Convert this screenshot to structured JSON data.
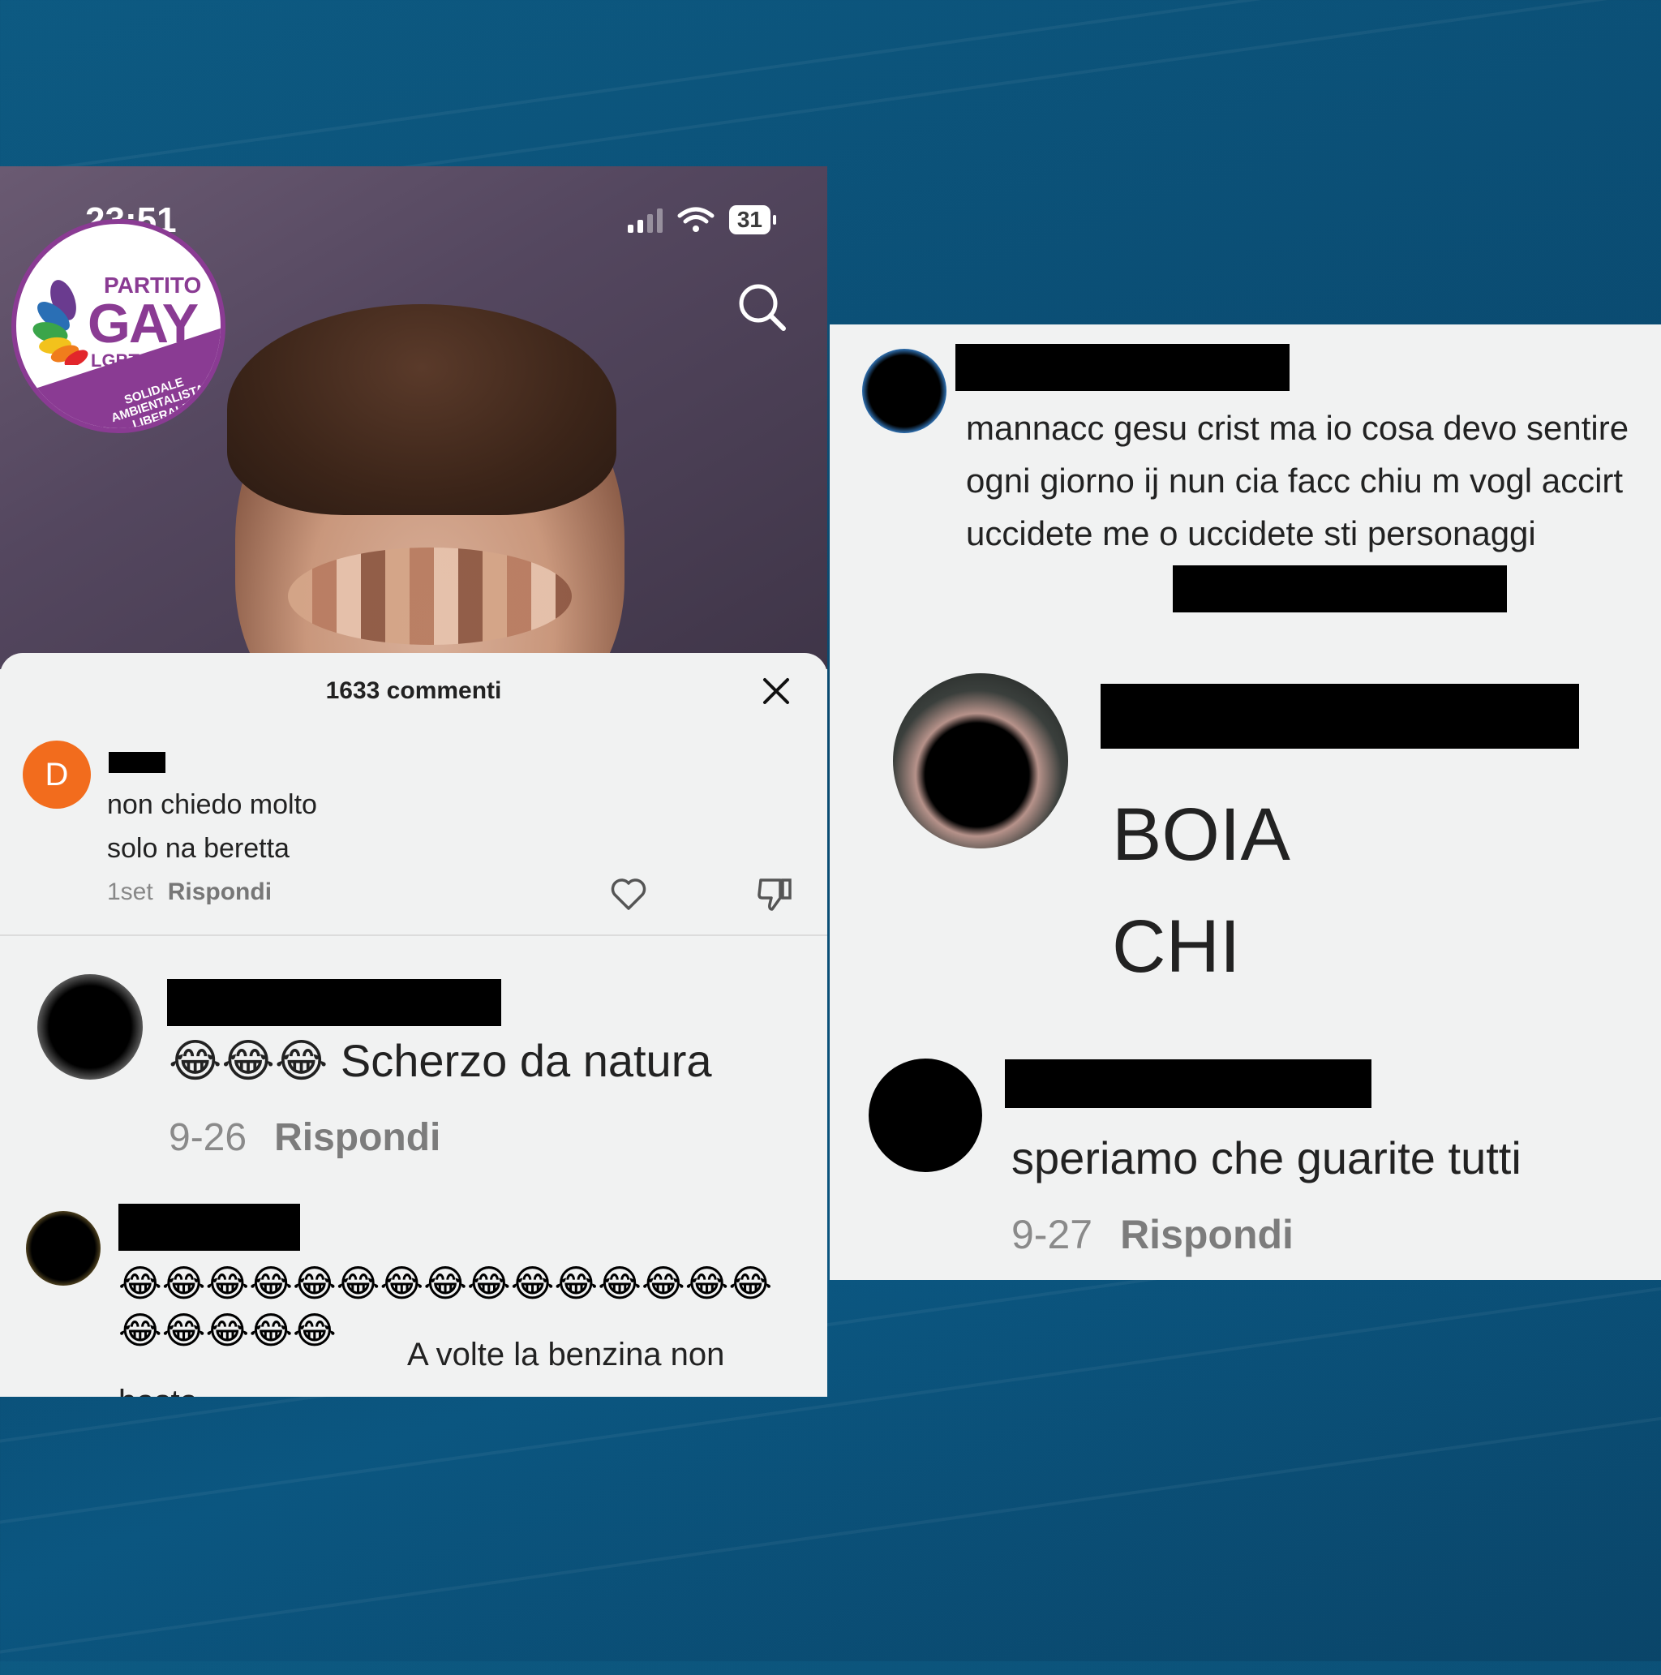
{
  "left": {
    "status": {
      "time": "23:51",
      "battery": "31"
    },
    "logo": {
      "line1": "PARTITO",
      "line2": "GAY",
      "line3": "LGBT+",
      "band": "SOLIDALE AMBIENTALISTA LIBERALE"
    },
    "comments_header": "1633 commenti",
    "comment1": {
      "avatar_letter": "D",
      "text_line1": "non chiedo molto",
      "text_line2": "solo na beretta",
      "date": "1set",
      "reply": "Rispondi"
    },
    "comment2": {
      "text": "😂😂😂 Scherzo da natura",
      "date": "9-26",
      "reply": "Rispondi"
    },
    "comment3": {
      "emoji": "😂😂😂😂😂😂😂😂😂😂😂😂😂😂😂😂😂😂😂😂",
      "text": "A volte la benzina non basta"
    }
  },
  "right": {
    "comment1": {
      "text": "mannacc gesu crist ma io cosa devo sentire ogni giorno ij nun cia facc chiu m vogl accirt uccidete me o uccidete sti personaggi"
    },
    "comment2": {
      "line1": "BOIA",
      "line2": "CHI"
    },
    "comment3": {
      "text": "speriamo che guarite tutti",
      "date": "9-27",
      "reply": "Rispondi"
    }
  }
}
